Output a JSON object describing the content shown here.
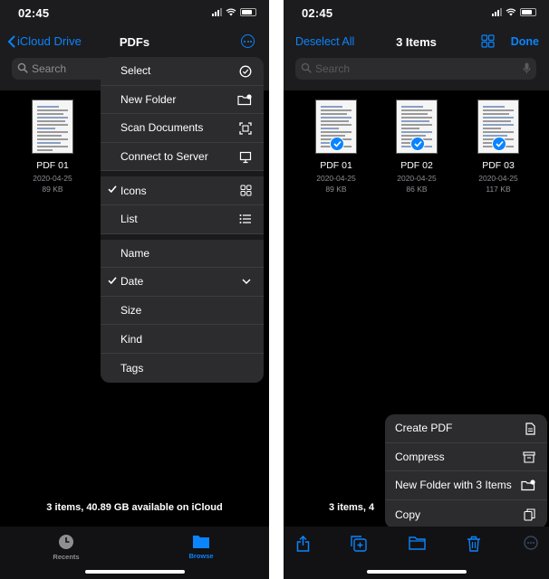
{
  "left": {
    "status_time": "02:45",
    "nav_back_label": "iCloud Drive",
    "nav_title": "PDFs",
    "search_placeholder": "Search",
    "file": {
      "name": "PDF 01",
      "date": "2020-04-25",
      "size": "89 KB"
    },
    "menu": {
      "group1": [
        {
          "label": "Select",
          "icon": "select-circle-icon"
        },
        {
          "label": "New Folder",
          "icon": "new-folder-icon"
        },
        {
          "label": "Scan Documents",
          "icon": "scan-icon"
        },
        {
          "label": "Connect to Server",
          "icon": "monitor-icon"
        }
      ],
      "group2": [
        {
          "label": "Icons",
          "icon": "grid-icon",
          "checked": true
        },
        {
          "label": "List",
          "icon": "list-icon",
          "checked": false
        }
      ],
      "group3": [
        {
          "label": "Name",
          "checked": false
        },
        {
          "label": "Date",
          "checked": true,
          "icon": "chevron-down-icon"
        },
        {
          "label": "Size",
          "checked": false
        },
        {
          "label": "Kind",
          "checked": false
        },
        {
          "label": "Tags",
          "checked": false
        }
      ]
    },
    "storage_text": "3 items, 40.89 GB available on iCloud",
    "tabs": {
      "recents": "Recents",
      "browse": "Browse"
    }
  },
  "right": {
    "status_time": "02:45",
    "deselect_label": "Deselect All",
    "nav_title": "3 Items",
    "done_label": "Done",
    "search_placeholder": "Search",
    "files": [
      {
        "name": "PDF 01",
        "date": "2020-04-25",
        "size": "89 KB"
      },
      {
        "name": "PDF 02",
        "date": "2020-04-25",
        "size": "86 KB"
      },
      {
        "name": "PDF 03",
        "date": "2020-04-25",
        "size": "117 KB"
      }
    ],
    "storage_text": "3 items, 4",
    "menu": [
      {
        "label": "Create PDF",
        "icon": "document-icon"
      },
      {
        "label": "Compress",
        "icon": "archive-box-icon"
      },
      {
        "label": "New Folder with 3 Items",
        "icon": "new-folder-icon"
      },
      {
        "label": "Copy",
        "icon": "copy-icon"
      }
    ],
    "toolbar_icons": [
      "share-icon",
      "duplicate-icon",
      "folder-icon",
      "trash-icon",
      "more-icon"
    ]
  },
  "colors": {
    "accent": "#0a84ff",
    "background": "#000000",
    "bar": "#1c1c1e",
    "menu": "#2c2c2e"
  }
}
